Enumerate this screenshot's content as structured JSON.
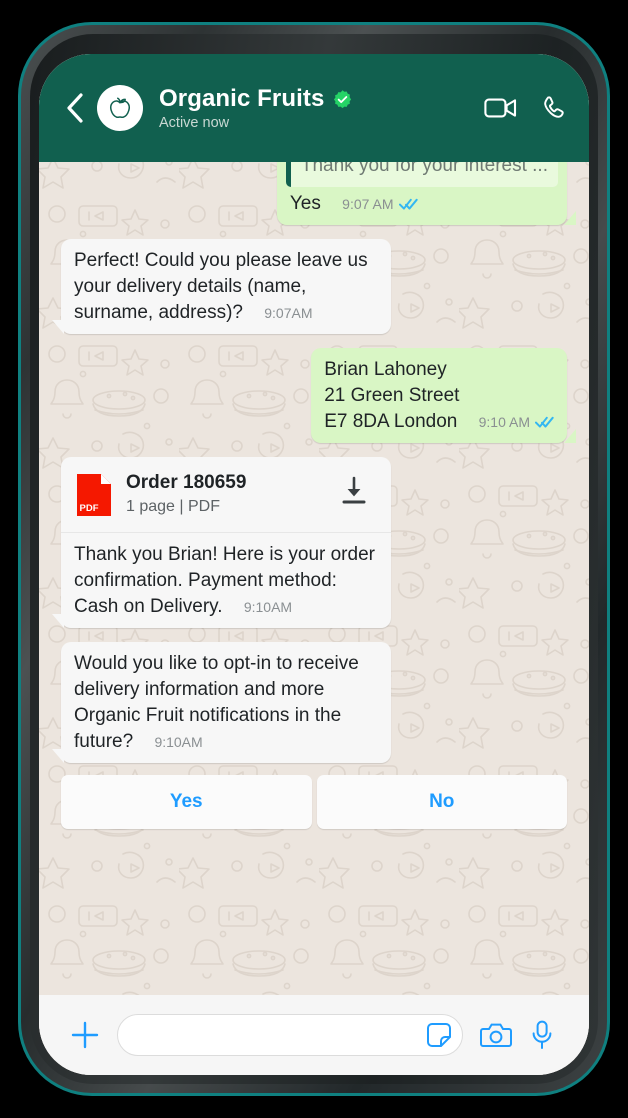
{
  "header": {
    "contact_name": "Organic Fruits",
    "status": "Active now",
    "verified": true,
    "back_icon": "chevron-left-icon",
    "avatar_icon": "apple-icon",
    "video_call_icon": "video-camera-icon",
    "voice_call_icon": "phone-icon",
    "bg_color": "#11604f"
  },
  "theme": {
    "wallpaper_color": "#ece5de",
    "outgoing_bubble": "#d9f6c5",
    "incoming_bubble": "#f7f7f7",
    "tick_blue": "#34b7f1",
    "accent_blue": "#1f9cff",
    "pdf_red": "#f51800"
  },
  "messages": [
    {
      "direction": "out",
      "quote": "Thank you for your interest ...",
      "text": "Yes",
      "time": "9:07 AM",
      "ticks": "read"
    },
    {
      "direction": "in",
      "text": "Perfect! Could you please leave us your delivery details (name, surname, address)?",
      "time": "9:07AM"
    },
    {
      "direction": "out",
      "text": "Brian Lahoney\n21 Green Street\nE7 8DA London",
      "time": "9:10 AM",
      "ticks": "read"
    },
    {
      "direction": "in",
      "attachment": {
        "title": "Order 180659",
        "subtitle": "1 page | PDF",
        "file_type": "PDF",
        "icon": "pdf-file-icon",
        "action_icon": "download-icon"
      },
      "text": "Thank you Brian! Here is your order confirmation. Payment method: Cash on Delivery.",
      "time": "9:10AM"
    },
    {
      "direction": "in",
      "text": "Would you like to opt-in to receive delivery information and more Organic Fruit notifications in the future?",
      "time": "9:10AM"
    }
  ],
  "quick_replies": [
    {
      "label": "Yes"
    },
    {
      "label": "No"
    }
  ],
  "composer": {
    "attach_icon": "plus-icon",
    "input_value": "",
    "input_placeholder": "",
    "sticker_icon": "sticker-icon",
    "camera_icon": "camera-icon",
    "mic_icon": "microphone-icon"
  }
}
